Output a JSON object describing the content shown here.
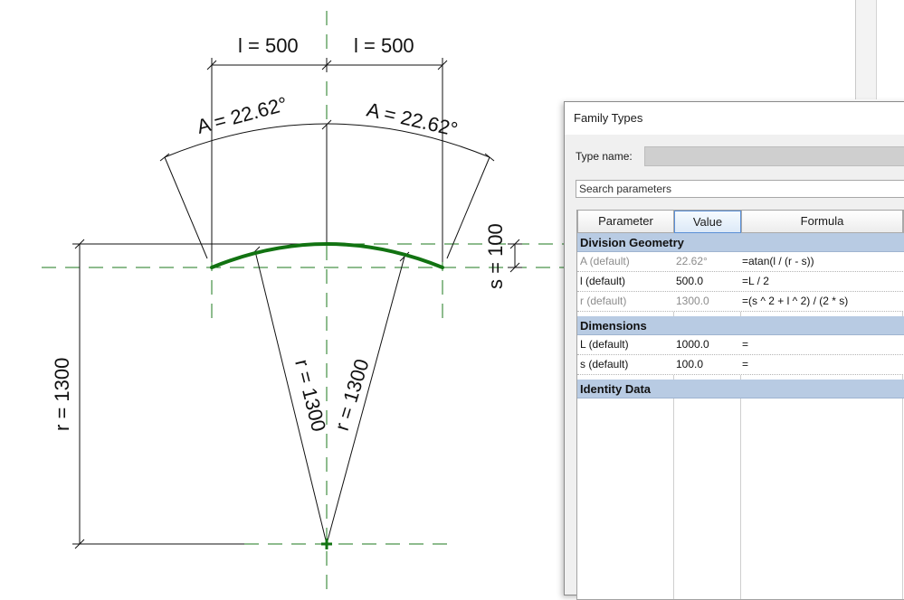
{
  "drawing": {
    "dim_l_left": "l = 500",
    "dim_l_right": "l = 500",
    "dim_A_left": "A = 22.62°",
    "dim_A_right": "A = 22.62°",
    "dim_s": "s = 100",
    "dim_r_left": "r = 1300",
    "dim_r_center_left": "r = 1300",
    "dim_r_center_right": "r = 1300",
    "arc_color": "#127312",
    "ref_line_color": "#1e7a1e"
  },
  "dialog": {
    "title": "Family Types",
    "type_name_label": "Type name:",
    "type_name_value": "",
    "search_placeholder": "Search parameters",
    "columns": {
      "parameter": "Parameter",
      "value": "Value",
      "formula": "Formula"
    },
    "groups": [
      {
        "name": "Division Geometry",
        "rows": [
          {
            "parameter": "A (default)",
            "value": "22.62°",
            "formula": "=atan(l / (r - s))",
            "reporting": true
          },
          {
            "parameter": "l (default)",
            "value": "500.0",
            "formula": "=L / 2",
            "reporting": false
          },
          {
            "parameter": "r (default)",
            "value": "1300.0",
            "formula": "=(s ^ 2 + l ^ 2) / (2 * s)",
            "reporting": true
          }
        ]
      },
      {
        "name": "Dimensions",
        "rows": [
          {
            "parameter": "L (default)",
            "value": "1000.0",
            "formula": "=",
            "reporting": false
          },
          {
            "parameter": "s (default)",
            "value": "100.0",
            "formula": "=",
            "reporting": false
          }
        ]
      },
      {
        "name": "Identity Data",
        "rows": []
      }
    ]
  }
}
